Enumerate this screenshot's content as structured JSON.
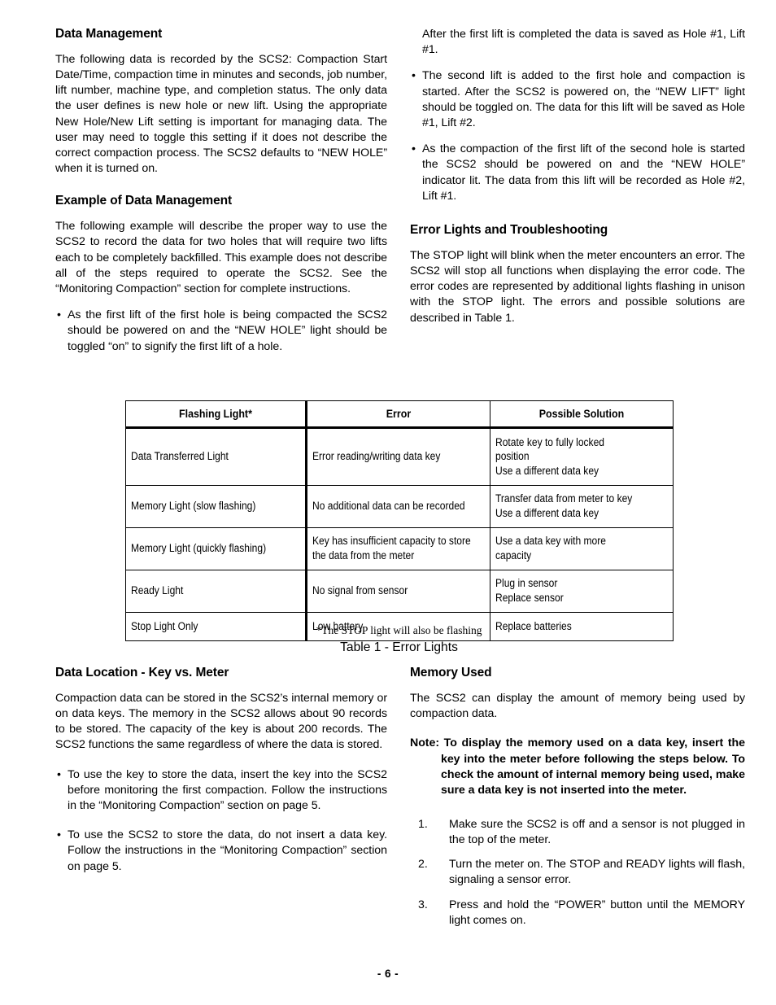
{
  "document": {
    "page_number_label": "- 6 -"
  },
  "left_column_top": {
    "section1": {
      "heading": "Data Management",
      "paragraph": "The following data is recorded by the SCS2:  Compaction Start Date/Time, compaction time in minutes and seconds, job number, lift number, machine type, and completion status.  The only data the user defines is new hole or new lift.  Using the appropriate New Hole/New Lift setting is important for managing data.  The user may need to toggle this setting if it does not describe the correct compaction process.  The SCS2 defaults to “NEW HOLE” when it is turned on."
    },
    "section2": {
      "heading": "Example of Data Management",
      "paragraph": "The following example will describe the proper way to use the SCS2 to record the data for two holes that will require two lifts each to be completely backfilled.  This example does not describe all of the steps required to operate the SCS2.   See the “Monitoring Compaction” section for complete instructions.",
      "bullets": [
        "As the first lift of the first hole is being compacted the SCS2 should be powered on and the “NEW HOLE” light should be toggled “on” to signify the first lift of a hole."
      ]
    }
  },
  "right_column_top": {
    "continuation_text": "After the first lift is completed the data is saved as Hole #1, Lift #1.",
    "bullets": [
      "The second lift is added to the first hole and compaction is started.  After the SCS2 is powered on, the “NEW LIFT” light should be toggled on.  The data for this lift will be saved as Hole #1, Lift #2.",
      "As the compaction of the first lift of the second hole is started the SCS2 should be powered on and the “NEW HOLE” indicator lit.   The data from this lift will be recorded as Hole #2, Lift #1."
    ],
    "section": {
      "heading": "Error Lights and Troubleshooting",
      "paragraph": "The STOP light will blink when the meter encounters an error.  The SCS2 will stop all functions when displaying the error code.  The error codes are represented by additional lights flashing in unison with the STOP light.  The errors and possible solutions are described in Table 1."
    }
  },
  "error_table": {
    "columns": [
      "Flashing Light*",
      "Error",
      "Possible Solution"
    ],
    "rows": [
      {
        "light": "Data Transferred Light",
        "error": "Error reading/writing data key",
        "solution_lines": [
          "Rotate key to fully locked",
          "position",
          "Use a different data key"
        ]
      },
      {
        "light": "Memory Light (slow flashing)",
        "error": "No additional data can be recorded",
        "solution_lines": [
          "Transfer data from meter to key",
          "Use a different data key"
        ]
      },
      {
        "light": "Memory Light (quickly flashing)",
        "error": "Key has insufficient capacity to store the data from the meter",
        "solution_lines": [
          "Use a data key with more",
          "capacity"
        ]
      },
      {
        "light": "Ready Light",
        "error": "No signal from sensor",
        "solution_lines": [
          "Plug in sensor",
          "Replace sensor"
        ]
      },
      {
        "light": "Stop Light Only",
        "error": "Low battery",
        "solution_lines": [
          "Replace batteries"
        ]
      }
    ],
    "footnote": "*The STOP light will also be flashing",
    "caption": "Table 1 - Error Lights"
  },
  "left_column_bottom": {
    "heading": "Data Location - Key vs. Meter",
    "paragraph": "Compaction data can be stored in the SCS2’s internal memory or on data keys.  The memory in the SCS2 allows about 90 records to be stored.  The capacity of the key is about 200 records.   The SCS2 functions the same regardless of where the data is stored.",
    "bullets": [
      "To use the key to store the data, insert the key into the SCS2 before monitoring the first compaction.  Follow the instructions in the “Monitoring Compaction” section on page 5.",
      "To use the SCS2 to store the data, do not insert a data key.   Follow the instructions in the “Monitoring Compaction” section on page 5."
    ]
  },
  "right_column_bottom": {
    "heading": "Memory Used",
    "paragraph": "The SCS2 can display the amount of memory being used by compaction data.",
    "note": "Note: To display the memory used on a data key, insert the key into the meter before following the steps below.  To check the amount of internal memory being used, make sure a data key is not inserted into the meter.",
    "steps": [
      {
        "number": "1.",
        "text": "Make sure the SCS2 is off and a sensor is not plugged in the top of the meter."
      },
      {
        "number": "2.",
        "text": "Turn the meter on.  The STOP and READY lights will flash, signaling a sensor error."
      },
      {
        "number": "3.",
        "text": "Press and hold the “POWER” button until the MEMORY light comes on."
      }
    ]
  }
}
